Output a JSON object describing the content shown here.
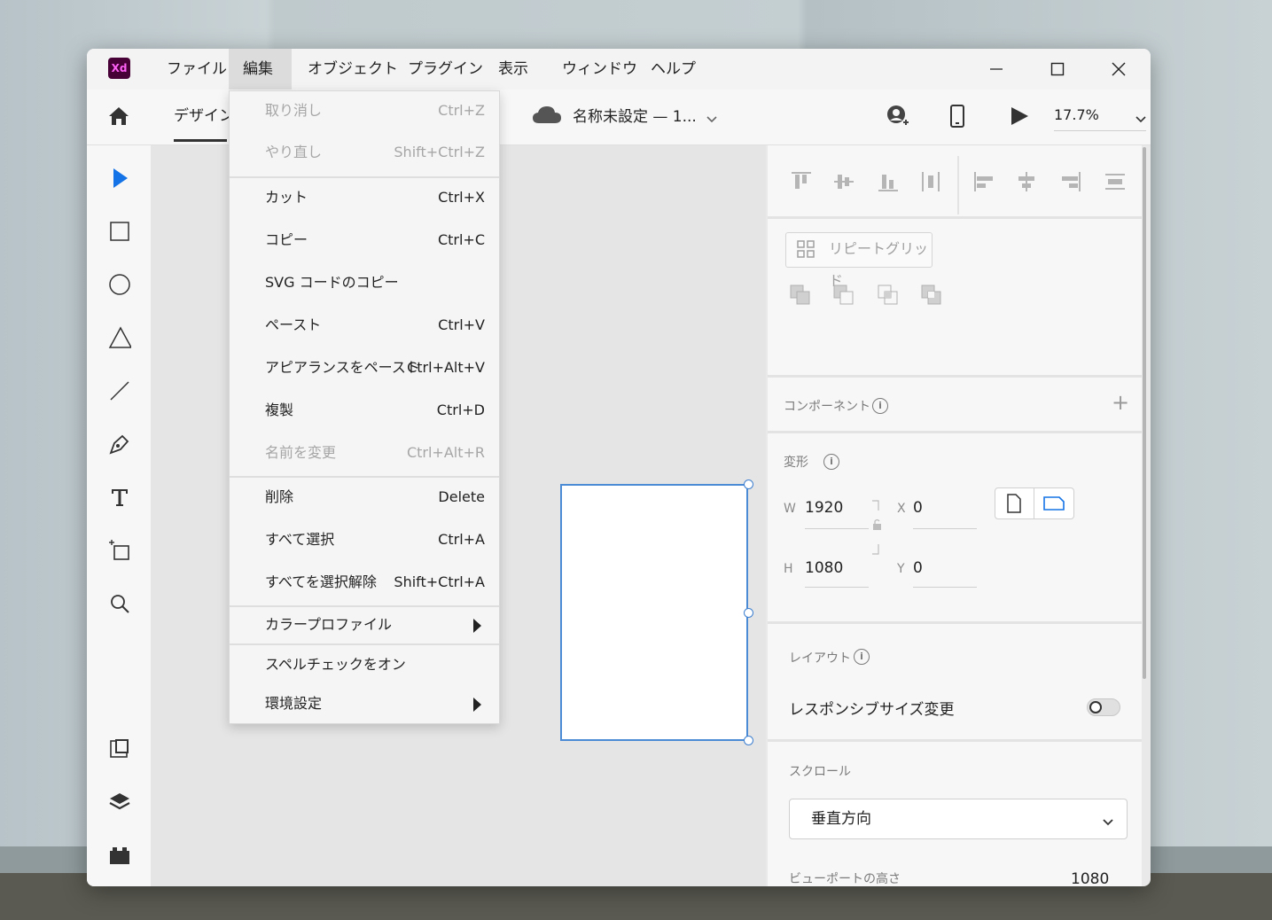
{
  "app": {
    "logo_text": "Xd"
  },
  "menubar": {
    "items": [
      {
        "label": "ファイル"
      },
      {
        "label": "編集"
      },
      {
        "label": "オブジェクト"
      },
      {
        "label": "プラグイン"
      },
      {
        "label": "表示"
      },
      {
        "label": "ウィンドウ"
      },
      {
        "label": "ヘルプ"
      }
    ],
    "active": "編集"
  },
  "toolbar": {
    "tab_design": "デザイン",
    "document_title": "名称未設定 — 1...",
    "zoom": "17.7%"
  },
  "edit_menu": {
    "items": [
      {
        "label": "取り消し",
        "shortcut": "Ctrl+Z",
        "disabled": true
      },
      {
        "label": "やり直し",
        "shortcut": "Shift+Ctrl+Z",
        "disabled": true
      },
      {
        "label": "カット",
        "shortcut": "Ctrl+X"
      },
      {
        "label": "コピー",
        "shortcut": "Ctrl+C"
      },
      {
        "label": "SVG コードのコピー",
        "shortcut": ""
      },
      {
        "label": "ペースト",
        "shortcut": "Ctrl+V"
      },
      {
        "label": "アピアランスをペースト",
        "shortcut": "Ctrl+Alt+V"
      },
      {
        "label": "複製",
        "shortcut": "Ctrl+D"
      },
      {
        "label": "名前を変更",
        "shortcut": "Ctrl+Alt+R",
        "disabled": true
      },
      {
        "label": "削除",
        "shortcut": "Delete"
      },
      {
        "label": "すべて選択",
        "shortcut": "Ctrl+A"
      },
      {
        "label": "すべてを選択解除",
        "shortcut": "Shift+Ctrl+A"
      },
      {
        "label": "カラープロファイル",
        "submenu": true
      },
      {
        "label": "スペルチェックをオン",
        "shortcut": ""
      },
      {
        "label": "環境設定",
        "submenu": true
      }
    ]
  },
  "right_panel": {
    "repeat_grid": "リピートグリッド",
    "component_heading": "コンポーネント",
    "transform_heading": "変形",
    "w_label": "W",
    "w_value": "1920",
    "h_label": "H",
    "h_value": "1080",
    "x_label": "X",
    "x_value": "0",
    "y_label": "Y",
    "y_value": "0",
    "layout_heading": "レイアウト",
    "responsive_label": "レスポンシブサイズ変更",
    "responsive_enabled": false,
    "scroll_heading": "スクロール",
    "scroll_value": "垂直方向",
    "viewport_label": "ビューポートの高さ",
    "viewport_value": "1080"
  },
  "colors": {
    "xd_logo_bg": "#470137",
    "xd_logo_fg": "#ff61f6",
    "selection": "#4b8bd6"
  }
}
